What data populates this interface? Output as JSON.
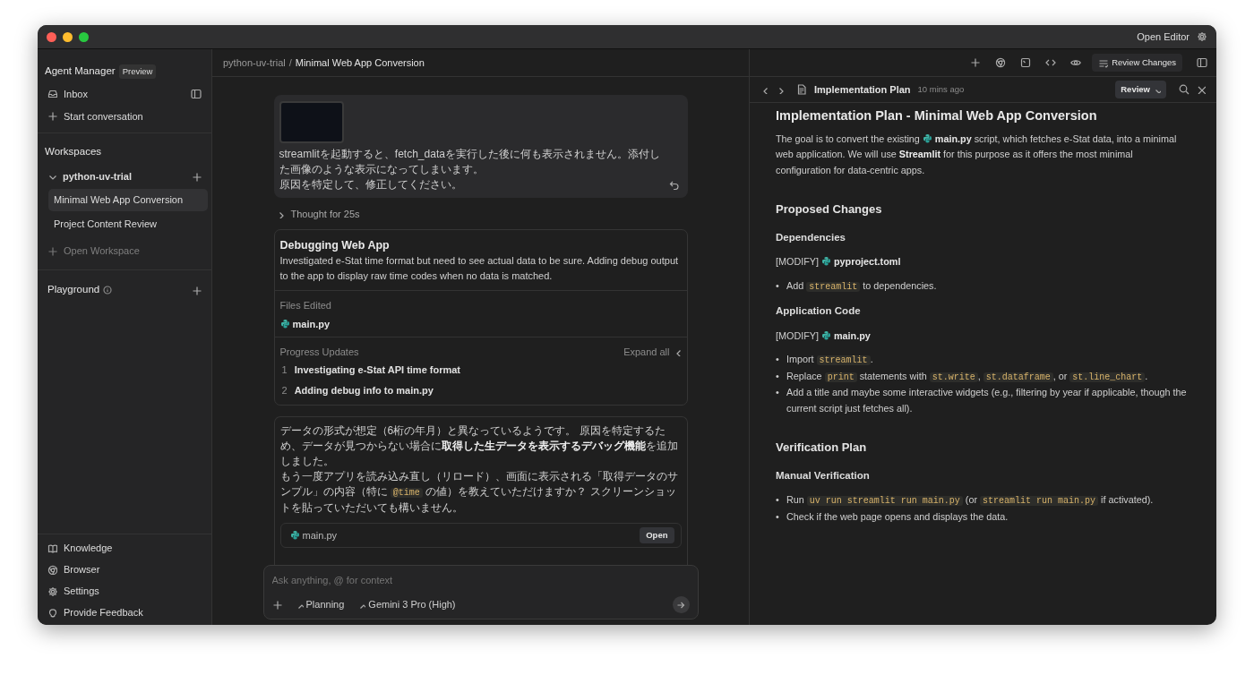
{
  "window": {
    "open_editor": "Open Editor"
  },
  "sidebar": {
    "title": "Agent Manager",
    "badge": "Preview",
    "nav": [
      {
        "label": "Inbox"
      },
      {
        "label": "Start conversation"
      }
    ],
    "workspaces_heading": "Workspaces",
    "workspace": {
      "name": "python-uv-trial",
      "expanded": true,
      "conversations": [
        {
          "label": "Minimal Web App Conversion",
          "selected": true
        },
        {
          "label": "Project Content Review",
          "selected": false
        }
      ]
    },
    "open_workspace": "Open Workspace",
    "playground": "Playground",
    "footer": [
      {
        "label": "Knowledge"
      },
      {
        "label": "Browser"
      },
      {
        "label": "Settings"
      },
      {
        "label": "Provide Feedback"
      }
    ]
  },
  "breadcrumb": [
    "python-uv-trial",
    "Minimal Web App Conversion"
  ],
  "breadcrumb_separator": "/",
  "toolbar": {
    "review_changes": "Review Changes"
  },
  "chat": [
    {
      "kind": "user",
      "lines": [
        "streamlitを起動すると、fetch_dataを実行した後に何も表示されません。添付した画像のような表示になってしまいます。",
        "原因を特定して、修正してください。"
      ]
    },
    {
      "kind": "thought",
      "label": "Thought for 25s",
      "expanded": false
    },
    {
      "kind": "task",
      "title": "Debugging Web App",
      "summary": "Investigated e-Stat time format but need to see actual data to be sure. Adding debug output to the app to display raw time codes when no data is matched.",
      "files_label": "Files Edited",
      "files": [
        "main.py"
      ],
      "progress_label": "Progress Updates",
      "expand_label": "Expand all",
      "steps": [
        {
          "number": "1",
          "text": "Investigating e-Stat API time format"
        },
        {
          "number": "2",
          "text": "Adding debug info to main.py"
        }
      ]
    },
    {
      "kind": "reply",
      "paragraphs": [
        [
          {
            "kind": "text",
            "text": "データの形式が想定（6桁の年月）と異なっているようです。 原因を特定するため、データが見つからない場合に"
          },
          {
            "kind": "bold",
            "text": "取得した生データを表示するデバッグ機能"
          },
          {
            "kind": "text",
            "text": "を追加しました。"
          }
        ],
        [
          {
            "kind": "text",
            "text": "もう一度アプリを読み込み直し（リロード）、画面に表示される「取得データのサンプル」の内容（特に "
          },
          {
            "kind": "code",
            "text": "@time"
          },
          {
            "kind": "text",
            "text": " の値）を教えていただけますか？ スクリーンショットを貼っていただいても構いません。"
          }
        ]
      ],
      "file": {
        "name": "main.py",
        "button": "Open"
      }
    }
  ],
  "composer": {
    "placeholder": "Ask anything, @ for context",
    "mode": "Planning",
    "model": "Gemini 3 Pro (High)"
  },
  "document": {
    "tab_title": "Implementation Plan",
    "time": "10 mins ago",
    "review": "Review",
    "blocks": [
      {
        "kind": "h1",
        "segments": [
          {
            "kind": "text",
            "text": "Implementation Plan - Minimal Web App Conversion"
          }
        ]
      },
      {
        "kind": "p",
        "segments": [
          {
            "kind": "text",
            "text": "The goal is to convert the existing "
          },
          {
            "kind": "file",
            "text": "main.py"
          },
          {
            "kind": "text",
            "text": " script, which fetches e-Stat data, into a minimal web application. We will use "
          },
          {
            "kind": "bold",
            "text": "Streamlit"
          },
          {
            "kind": "text",
            "text": " for this purpose as it offers the most minimal configuration for data-centric apps."
          }
        ]
      },
      {
        "kind": "h2",
        "segments": [
          {
            "kind": "text",
            "text": "Proposed Changes"
          }
        ]
      },
      {
        "kind": "h3",
        "segments": [
          {
            "kind": "text",
            "text": "Dependencies"
          }
        ]
      },
      {
        "kind": "p",
        "segments": [
          {
            "kind": "text",
            "text": "[MODIFY] "
          },
          {
            "kind": "file",
            "text": "pyproject.toml"
          }
        ]
      },
      {
        "kind": "ul",
        "bullet": "•",
        "items": [
          [
            {
              "kind": "text",
              "text": "Add "
            },
            {
              "kind": "code",
              "text": "streamlit"
            },
            {
              "kind": "text",
              "text": " to dependencies."
            }
          ]
        ]
      },
      {
        "kind": "h3",
        "segments": [
          {
            "kind": "text",
            "text": "Application Code"
          }
        ]
      },
      {
        "kind": "p",
        "segments": [
          {
            "kind": "text",
            "text": "[MODIFY] "
          },
          {
            "kind": "file",
            "text": "main.py"
          }
        ]
      },
      {
        "kind": "ul",
        "bullet": "•",
        "items": [
          [
            {
              "kind": "text",
              "text": "Import "
            },
            {
              "kind": "code",
              "text": "streamlit"
            },
            {
              "kind": "text",
              "text": "."
            }
          ],
          [
            {
              "kind": "text",
              "text": "Replace "
            },
            {
              "kind": "code",
              "text": "print"
            },
            {
              "kind": "text",
              "text": " statements with "
            },
            {
              "kind": "code",
              "text": "st.write"
            },
            {
              "kind": "text",
              "text": ", "
            },
            {
              "kind": "code",
              "text": "st.dataframe"
            },
            {
              "kind": "text",
              "text": ", or "
            },
            {
              "kind": "code",
              "text": "st.line_chart"
            },
            {
              "kind": "text",
              "text": "."
            }
          ],
          [
            {
              "kind": "text",
              "text": "Add a title and maybe some interactive widgets (e.g., filtering by year if applicable, though the current script just fetches all)."
            }
          ]
        ]
      },
      {
        "kind": "h2",
        "segments": [
          {
            "kind": "text",
            "text": "Verification Plan"
          }
        ]
      },
      {
        "kind": "h3",
        "segments": [
          {
            "kind": "text",
            "text": "Manual Verification"
          }
        ]
      },
      {
        "kind": "ul",
        "bullet": "•",
        "items": [
          [
            {
              "kind": "text",
              "text": "Run "
            },
            {
              "kind": "code",
              "text": "uv run streamlit run main.py"
            },
            {
              "kind": "text",
              "text": " (or "
            },
            {
              "kind": "code",
              "text": "streamlit run main.py"
            },
            {
              "kind": "text",
              "text": " if activated)."
            }
          ],
          [
            {
              "kind": "text",
              "text": "Check if the web page opens and displays the data."
            }
          ]
        ]
      }
    ]
  }
}
